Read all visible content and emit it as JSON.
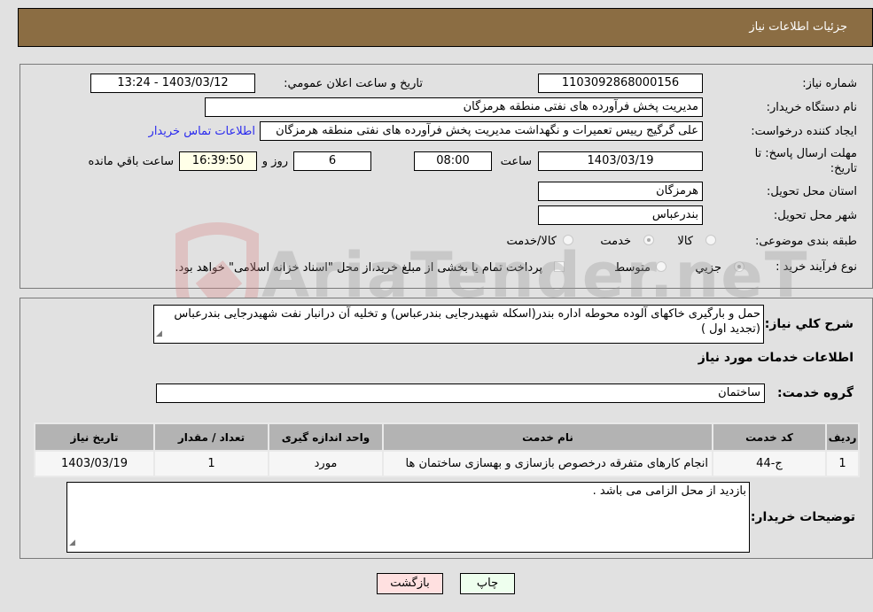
{
  "header": {
    "title": "جزئیات اطلاعات نیاز"
  },
  "details": {
    "need_number_label": "شماره نیاز:",
    "need_number": "1103092868000156",
    "announce_label": "تاریخ و ساعت اعلان عمومي:",
    "announce_value": "1403/03/12 - 13:24",
    "buyer_org_label": "نام دستگاه خریدار:",
    "buyer_org": "مدیریت پخش فرآورده های نفتی منطقه هرمزگان",
    "creator_label": "ایجاد کننده درخواست:",
    "creator": "علی گرگیج رییس تعمیرات و نگهداشت مدیریت پخش فرآورده های نفتی منطقه هرمزگان",
    "contact_link": "اطلاعات تماس خریدار",
    "deadline_label": "مهلت ارسال پاسخ: تا تاریخ:",
    "deadline_date": "1403/03/19",
    "time_label": "ساعت",
    "deadline_time": "08:00",
    "days_value": "6",
    "days_label": "روز و",
    "remaining_time": "16:39:50",
    "remaining_label": "ساعت باقي مانده",
    "province_label": "استان محل تحویل:",
    "province": "هرمزگان",
    "city_label": "شهر محل تحویل:",
    "city": "بندرعباس",
    "category_label": "طبقه بندی موضوعی:",
    "category_options": [
      {
        "label": "کالا",
        "selected": false
      },
      {
        "label": "خدمت",
        "selected": true
      },
      {
        "label": "کالا/خدمت",
        "selected": false
      }
    ],
    "process_label": "نوع فرآیند خرید :",
    "process_options": [
      {
        "label": "جزيي",
        "selected": true
      },
      {
        "label": "متوسط",
        "selected": false
      }
    ],
    "treasury_note": "پرداخت تمام یا بخشی از مبلغ خرید،از محل \"اسناد خزانه اسلامی\" خواهد بود."
  },
  "description": {
    "label": "شرح کلي نیاز:",
    "text": "حمل و بارگیری خاکهای آلوده محوطه اداره بندر(اسکله شهیدرجایی بندرعباس) و تخلیه آن درانبار نفت شهیدرجایی بندرعباس (تجدید اول )"
  },
  "services": {
    "section_title": "اطلاعات خدمات مورد نیاز",
    "group_label": "گروه خدمت:",
    "group_value": "ساختمان",
    "columns": [
      "ردیف",
      "کد خدمت",
      "نام خدمت",
      "واحد اندازه گیری",
      "تعداد / مقدار",
      "تاریخ نیاز"
    ],
    "rows": [
      [
        "1",
        "ج-44",
        "انجام کارهای متفرقه درخصوص بازسازی و بهسازی ساختمان ها",
        "مورد",
        "1",
        "1403/03/19"
      ]
    ]
  },
  "buyer_notes": {
    "label": "توضیحات خریدار:",
    "text": "بازدید از محل الزامی می باشد ."
  },
  "buttons": {
    "print": "چاپ",
    "back": "بازگشت"
  },
  "colors": {
    "header": "#8b6d43",
    "link": "#2a2aee",
    "print_bg": "#eeffee",
    "back_bg": "#ffe0e0"
  },
  "watermark": "AriaTender.neT"
}
